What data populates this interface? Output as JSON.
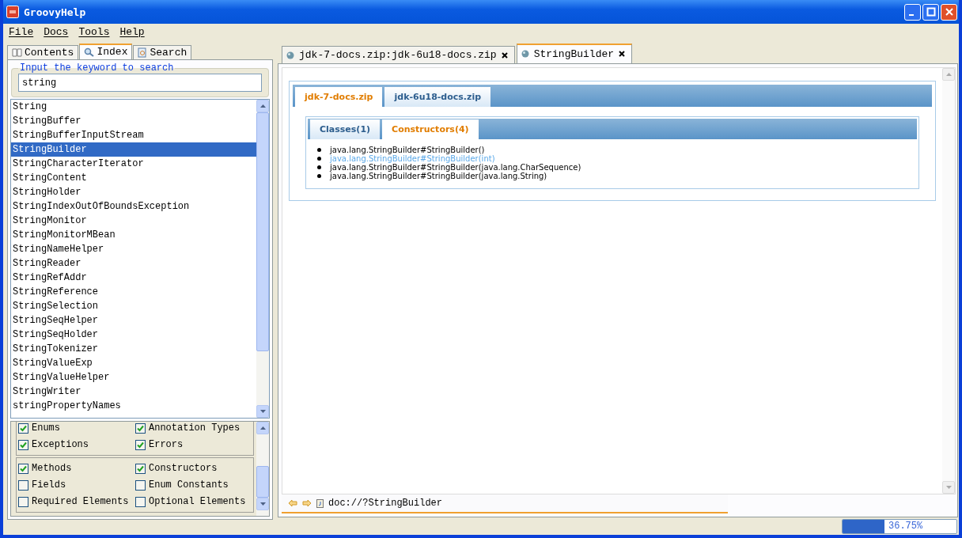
{
  "window": {
    "title": "GroovyHelp"
  },
  "menu": [
    "File",
    "Docs",
    "Tools",
    "Help"
  ],
  "left_tabs": [
    {
      "label": "Contents",
      "selected": false
    },
    {
      "label": "Index",
      "selected": true
    },
    {
      "label": "Search",
      "selected": false
    }
  ],
  "keyword": {
    "legend": "Input the keyword to search",
    "value": "string"
  },
  "index_items": [
    {
      "label": "String",
      "selected": false
    },
    {
      "label": "StringBuffer",
      "selected": false
    },
    {
      "label": "StringBufferInputStream",
      "selected": false
    },
    {
      "label": "StringBuilder",
      "selected": true
    },
    {
      "label": "StringCharacterIterator",
      "selected": false
    },
    {
      "label": "StringContent",
      "selected": false
    },
    {
      "label": "StringHolder",
      "selected": false
    },
    {
      "label": "StringIndexOutOfBoundsException",
      "selected": false
    },
    {
      "label": "StringMonitor",
      "selected": false
    },
    {
      "label": "StringMonitorMBean",
      "selected": false
    },
    {
      "label": "StringNameHelper",
      "selected": false
    },
    {
      "label": "StringReader",
      "selected": false
    },
    {
      "label": "StringRefAddr",
      "selected": false
    },
    {
      "label": "StringReference",
      "selected": false
    },
    {
      "label": "StringSelection",
      "selected": false
    },
    {
      "label": "StringSeqHelper",
      "selected": false
    },
    {
      "label": "StringSeqHolder",
      "selected": false
    },
    {
      "label": "StringTokenizer",
      "selected": false
    },
    {
      "label": "StringValueExp",
      "selected": false
    },
    {
      "label": "StringValueHelper",
      "selected": false
    },
    {
      "label": "StringWriter",
      "selected": false
    },
    {
      "label": "stringPropertyNames",
      "selected": false
    }
  ],
  "filter_groups": [
    [
      {
        "label": "Enums",
        "checked": true
      },
      {
        "label": "Annotation Types",
        "checked": true
      },
      {
        "label": "Exceptions",
        "checked": true
      },
      {
        "label": "Errors",
        "checked": true
      }
    ],
    [
      {
        "label": "Methods",
        "checked": true
      },
      {
        "label": "Constructors",
        "checked": true
      },
      {
        "label": "Fields",
        "checked": false
      },
      {
        "label": "Enum Constants",
        "checked": false
      },
      {
        "label": "Required Elements",
        "checked": false
      },
      {
        "label": "Optional Elements",
        "checked": false
      }
    ]
  ],
  "doc_tabs": [
    {
      "label": "jdk-7-docs.zip:jdk-6u18-docs.zip",
      "selected": false
    },
    {
      "label": "StringBuilder",
      "selected": true
    }
  ],
  "zip_tabs": [
    {
      "label": "jdk-7-docs.zip",
      "selected": true
    },
    {
      "label": "jdk-6u18-docs.zip",
      "selected": false
    }
  ],
  "kind_tabs": [
    {
      "label": "Classes(1)",
      "selected": false
    },
    {
      "label": "Constructors(4)",
      "selected": true
    }
  ],
  "results": [
    {
      "text": "java.lang.StringBuilder#StringBuilder()",
      "hovered": false
    },
    {
      "text": "java.lang.StringBuilder#StringBuilder(int)",
      "hovered": true
    },
    {
      "text": "java.lang.StringBuilder#StringBuilder(java.lang.CharSequence)",
      "hovered": false
    },
    {
      "text": "java.lang.StringBuilder#StringBuilder(java.lang.String)",
      "hovered": false
    }
  ],
  "address": "doc://?StringBuilder",
  "status_bar": {
    "memory": {
      "level": 0.3675,
      "reading": "36.75%"
    }
  }
}
